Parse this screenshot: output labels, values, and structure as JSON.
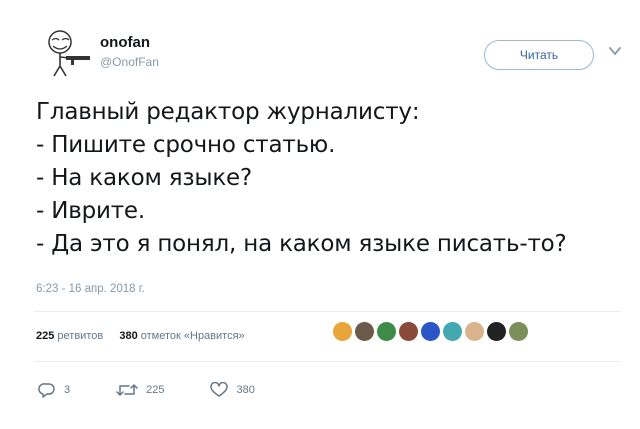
{
  "user": {
    "display_name": "onofan",
    "handle": "@OnofFan",
    "avatar_icon": "trollface-gunman-icon"
  },
  "follow_button": {
    "label": "Читать"
  },
  "menu_icon": "chevron-down-icon",
  "tweet": {
    "lines": [
      "Главный редактор журналисту:",
      "- Пишите срочно статью.",
      "- На каком языке?",
      "- Иврите.",
      "- Да это я понял, на каком языке писать-то?"
    ],
    "timestamp": "6:23 - 16 апр. 2018 г."
  },
  "stats": {
    "retweets_count": "225",
    "retweets_label": "ретвитов",
    "likes_count": "380",
    "likes_label": "отметок «Нравится»"
  },
  "likers": [
    {
      "name": "liker-1",
      "color": "#e8a53a"
    },
    {
      "name": "liker-2",
      "color": "#6b5a4a"
    },
    {
      "name": "liker-3",
      "color": "#3e8a48"
    },
    {
      "name": "liker-4",
      "color": "#8a4a3a"
    },
    {
      "name": "liker-5",
      "color": "#2b56c8"
    },
    {
      "name": "liker-6",
      "color": "#44a8b0"
    },
    {
      "name": "liker-7",
      "color": "#d9b38c"
    },
    {
      "name": "liker-8",
      "color": "#222222"
    },
    {
      "name": "liker-9",
      "color": "#7b8f5a"
    }
  ],
  "actions": {
    "reply_count": "3",
    "retweet_count": "225",
    "like_count": "380"
  }
}
